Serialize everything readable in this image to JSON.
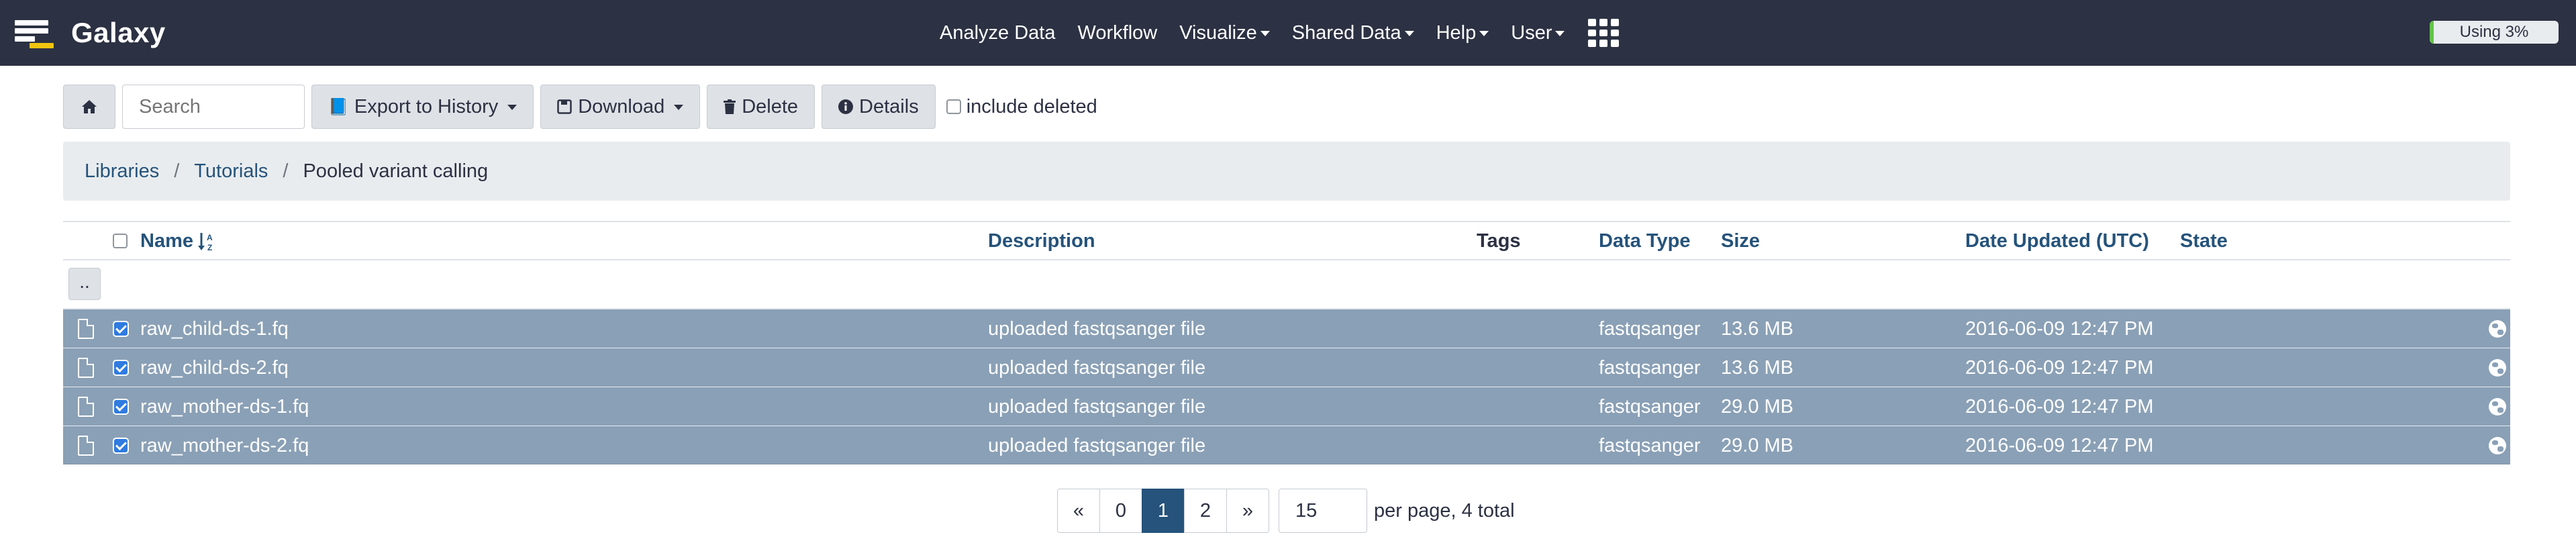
{
  "navbar": {
    "brand": "Galaxy",
    "items": [
      {
        "label": "Analyze Data",
        "dropdown": false
      },
      {
        "label": "Workflow",
        "dropdown": false
      },
      {
        "label": "Visualize",
        "dropdown": true
      },
      {
        "label": "Shared Data",
        "dropdown": true
      },
      {
        "label": "Help",
        "dropdown": true
      },
      {
        "label": "User",
        "dropdown": true
      }
    ],
    "apps_icon": "grid-icon",
    "quota": {
      "label": "Using 3%",
      "percent": 3
    }
  },
  "toolbar": {
    "home_icon": "home-icon",
    "search_placeholder": "Search",
    "export_label": "Export to History",
    "download_label": "Download",
    "delete_label": "Delete",
    "details_label": "Details",
    "include_deleted_label": "include deleted"
  },
  "breadcrumb": {
    "items": [
      "Libraries",
      "Tutorials"
    ],
    "separator": "/",
    "current": "Pooled variant calling"
  },
  "table": {
    "headers": {
      "name": "Name",
      "description": "Description",
      "tags": "Tags",
      "data_type": "Data Type",
      "size": "Size",
      "date_updated": "Date Updated (UTC)",
      "state": "State"
    },
    "parent_label": "..",
    "rows": [
      {
        "name": "raw_child-ds-1.fq",
        "description": "uploaded fastqsanger file",
        "tags": "",
        "data_type": "fastqsanger",
        "size": "13.6 MB",
        "date_updated": "2016-06-09 12:47 PM",
        "state": "",
        "selected": true
      },
      {
        "name": "raw_child-ds-2.fq",
        "description": "uploaded fastqsanger file",
        "tags": "",
        "data_type": "fastqsanger",
        "size": "13.6 MB",
        "date_updated": "2016-06-09 12:47 PM",
        "state": "",
        "selected": true
      },
      {
        "name": "raw_mother-ds-1.fq",
        "description": "uploaded fastqsanger file",
        "tags": "",
        "data_type": "fastqsanger",
        "size": "29.0 MB",
        "date_updated": "2016-06-09 12:47 PM",
        "state": "",
        "selected": true
      },
      {
        "name": "raw_mother-ds-2.fq",
        "description": "uploaded fastqsanger file",
        "tags": "",
        "data_type": "fastqsanger",
        "size": "29.0 MB",
        "date_updated": "2016-06-09 12:47 PM",
        "state": "",
        "selected": true
      }
    ]
  },
  "pagination": {
    "first": "«",
    "pages": [
      "0",
      "1",
      "2"
    ],
    "active_page": "1",
    "last": "»",
    "per_page": "15",
    "summary": "per page, 4 total"
  },
  "colors": {
    "navbar": "#2c3143",
    "selected_row": "#8aa0b6",
    "link": "#25537b",
    "active_page": "#25537b",
    "quota_fill": "#63c34a"
  }
}
